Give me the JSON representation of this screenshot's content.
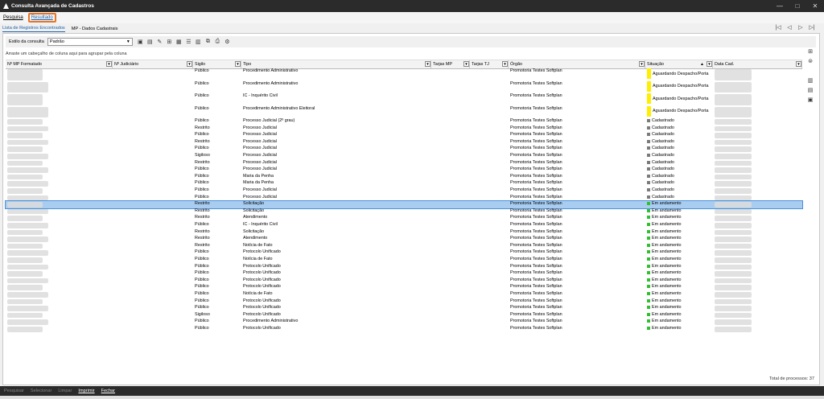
{
  "window": {
    "title": "Consulta Avançada de Cadastros",
    "controls": [
      "—",
      "□",
      "✕"
    ]
  },
  "menu": {
    "pesquisa": "Pesquisa",
    "resultado": "Resultado"
  },
  "subtabs": {
    "lista": "Lista de Registros Encontrados",
    "mp": "MP - Dados Cadastrais"
  },
  "stylebar": {
    "label": "Estilo da consulta",
    "value": "Padrão"
  },
  "group_hint": "Arraste um cabeçalho de coluna aqui para agrupar pela coluna",
  "columns": {
    "nmp": "Nº MP Formatado",
    "njud": "Nº Judiciário",
    "sigilo": "Sigilo",
    "tipo": "Tipo",
    "tarjasmp": "Tarjas MP",
    "tarjastj": "Tarjas TJ",
    "orgao": "Órgão",
    "situacao": "Situação",
    "datacad": "Data Cad."
  },
  "rows": [
    {
      "sigilo": "Público",
      "tipo": "Procedimento Administrativo",
      "orgao": "Promotoria Testes Softplan",
      "situacao": "Aguardando Despacho/Porta",
      "status": "yellow"
    },
    {
      "sigilo": "Público",
      "tipo": "Procedimento Administrativo",
      "orgao": "Promotoria Testes Softplan",
      "situacao": "Aguardando Despacho/Porta",
      "status": "yellow"
    },
    {
      "sigilo": "Público",
      "tipo": "IC - Inquérito Civil",
      "orgao": "Promotoria Testes Softplan",
      "situacao": "Aguardando Despacho/Porta",
      "status": "yellow"
    },
    {
      "sigilo": "Público",
      "tipo": "Procedimento Administrativo Eleitoral",
      "orgao": "Promotoria Testes Softplan",
      "situacao": "Aguardando Despacho/Porta",
      "status": "yellow"
    },
    {
      "sigilo": "Público",
      "tipo": "Processo Judicial (2º grau)",
      "orgao": "Promotoria Testes Softplan",
      "situacao": "Cadastrado",
      "status": "gray"
    },
    {
      "sigilo": "Restrito",
      "tipo": "Processo Judicial",
      "orgao": "Promotoria Testes Softplan",
      "situacao": "Cadastrado",
      "status": "gray"
    },
    {
      "sigilo": "Público",
      "tipo": "Processo Judicial",
      "orgao": "Promotoria Testes Softplan",
      "situacao": "Cadastrado",
      "status": "gray"
    },
    {
      "sigilo": "Restrito",
      "tipo": "Processo Judicial",
      "orgao": "Promotoria Testes Softplan",
      "situacao": "Cadastrado",
      "status": "gray"
    },
    {
      "sigilo": "Público",
      "tipo": "Processo Judicial",
      "orgao": "Promotoria Testes Softplan",
      "situacao": "Cadastrado",
      "status": "gray"
    },
    {
      "sigilo": "Sigiloso",
      "tipo": "Processo Judicial",
      "orgao": "Promotoria Testes Softplan",
      "situacao": "Cadastrado",
      "status": "gray"
    },
    {
      "sigilo": "Restrito",
      "tipo": "Processo Judicial",
      "orgao": "Promotoria Testes Softplan",
      "situacao": "Cadastrado",
      "status": "gray"
    },
    {
      "sigilo": "Público",
      "tipo": "Processo Judicial",
      "orgao": "Promotoria Testes Softplan",
      "situacao": "Cadastrado",
      "status": "gray"
    },
    {
      "sigilo": "Público",
      "tipo": "Maria da Penha",
      "orgao": "Promotoria Testes Softplan",
      "situacao": "Cadastrado",
      "status": "gray"
    },
    {
      "sigilo": "Público",
      "tipo": "Maria da Penha",
      "orgao": "Promotoria Testes Softplan",
      "situacao": "Cadastrado",
      "status": "gray"
    },
    {
      "sigilo": "Público",
      "tipo": "Processo Judicial",
      "orgao": "Promotoria Testes Softplan",
      "situacao": "Cadastrado",
      "status": "gray"
    },
    {
      "sigilo": "Público",
      "tipo": "Processo Judicial",
      "orgao": "Promotoria Testes Softplan",
      "situacao": "Cadastrado",
      "status": "gray"
    },
    {
      "sigilo": "Restrito",
      "tipo": "Solicitação",
      "orgao": "Promotoria Testes Softplan",
      "situacao": "Em andamento",
      "status": "green",
      "selected": true
    },
    {
      "sigilo": "Restrito",
      "tipo": "Solicitação",
      "orgao": "Promotoria Testes Softplan",
      "situacao": "Em andamento",
      "status": "green"
    },
    {
      "sigilo": "Restrito",
      "tipo": "Atendimento",
      "orgao": "Promotoria Testes Softplan",
      "situacao": "Em andamento",
      "status": "green"
    },
    {
      "sigilo": "Público",
      "tipo": "IC - Inquérito Civil",
      "orgao": "Promotoria Testes Softplan",
      "situacao": "Em andamento",
      "status": "green"
    },
    {
      "sigilo": "Restrito",
      "tipo": "Solicitação",
      "orgao": "Promotoria Testes Softplan",
      "situacao": "Em andamento",
      "status": "green"
    },
    {
      "sigilo": "Restrito",
      "tipo": "Atendimento",
      "orgao": "Promotoria Testes Softplan",
      "situacao": "Em andamento",
      "status": "green"
    },
    {
      "sigilo": "Restrito",
      "tipo": "Notícia de Fato",
      "orgao": "Promotoria Testes Softplan",
      "situacao": "Em andamento",
      "status": "green"
    },
    {
      "sigilo": "Público",
      "tipo": "Protocolo Unificado",
      "orgao": "Promotoria Testes Softplan",
      "situacao": "Em andamento",
      "status": "green"
    },
    {
      "sigilo": "Público",
      "tipo": "Notícia de Fato",
      "orgao": "Promotoria Testes Softplan",
      "situacao": "Em andamento",
      "status": "green"
    },
    {
      "sigilo": "Público",
      "tipo": "Protocolo Unificado",
      "orgao": "Promotoria Testes Softplan",
      "situacao": "Em andamento",
      "status": "green"
    },
    {
      "sigilo": "Público",
      "tipo": "Protocolo Unificado",
      "orgao": "Promotoria Testes Softplan",
      "situacao": "Em andamento",
      "status": "green"
    },
    {
      "sigilo": "Público",
      "tipo": "Protocolo Unificado",
      "orgao": "Promotoria Testes Softplan",
      "situacao": "Em andamento",
      "status": "green"
    },
    {
      "sigilo": "Público",
      "tipo": "Protocolo Unificado",
      "orgao": "Promotoria Testes Softplan",
      "situacao": "Em andamento",
      "status": "green"
    },
    {
      "sigilo": "Público",
      "tipo": "Notícia de Fato",
      "orgao": "Promotoria Testes Softplan",
      "situacao": "Em andamento",
      "status": "green"
    },
    {
      "sigilo": "Público",
      "tipo": "Protocolo Unificado",
      "orgao": "Promotoria Testes Softplan",
      "situacao": "Em andamento",
      "status": "green"
    },
    {
      "sigilo": "Público",
      "tipo": "Protocolo Unificado",
      "orgao": "Promotoria Testes Softplan",
      "situacao": "Em andamento",
      "status": "green"
    },
    {
      "sigilo": "Sigiloso",
      "tipo": "Protocolo Unificado",
      "orgao": "Promotoria Testes Softplan",
      "situacao": "Em andamento",
      "status": "green"
    },
    {
      "sigilo": "Público",
      "tipo": "Procedimento Administrativo",
      "orgao": "Promotoria Testes Softplan",
      "situacao": "Em andamento",
      "status": "green"
    },
    {
      "sigilo": "Público",
      "tipo": "Protocolo Unificado",
      "orgao": "Promotoria Testes Softplan",
      "situacao": "Em andamento",
      "status": "green"
    }
  ],
  "total": "Total de processos: 37",
  "bottom": {
    "pesquisar": "Pesquisar",
    "selecionar": "Selecionar",
    "limpar": "Limpar",
    "imprimir": "Imprimir",
    "fechar": "Fechar"
  },
  "colors": {
    "selected_row": "#a9cdf0",
    "highlight_border": "#e8742a",
    "titlebar": "#2b2b2b"
  }
}
